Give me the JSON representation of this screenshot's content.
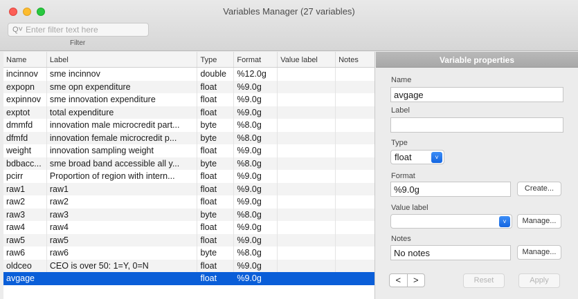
{
  "window": {
    "title": "Variables Manager (27 variables)"
  },
  "filter": {
    "placeholder": "Enter filter text here",
    "label": "Filter"
  },
  "table": {
    "columns": [
      "Name",
      "Label",
      "Type",
      "Format",
      "Value label",
      "Notes"
    ],
    "rows": [
      {
        "name": "incinnov",
        "label": "sme incinnov",
        "type": "double",
        "format": "%12.0g",
        "value_label": "",
        "notes": ""
      },
      {
        "name": "expopn",
        "label": "sme opn expenditure",
        "type": "float",
        "format": "%9.0g",
        "value_label": "",
        "notes": ""
      },
      {
        "name": "expinnov",
        "label": "sme innovation expenditure",
        "type": "float",
        "format": "%9.0g",
        "value_label": "",
        "notes": ""
      },
      {
        "name": "exptot",
        "label": "total expenditure",
        "type": "float",
        "format": "%9.0g",
        "value_label": "",
        "notes": ""
      },
      {
        "name": "dmmfd",
        "label": "innovation male microcredit part...",
        "type": "byte",
        "format": "%8.0g",
        "value_label": "",
        "notes": ""
      },
      {
        "name": "dfmfd",
        "label": "innovation female microcredit p...",
        "type": "byte",
        "format": "%8.0g",
        "value_label": "",
        "notes": ""
      },
      {
        "name": "weight",
        "label": "innovation sampling weight",
        "type": "float",
        "format": "%9.0g",
        "value_label": "",
        "notes": ""
      },
      {
        "name": "bdbacc...",
        "label": "sme broad band accessible all y...",
        "type": "byte",
        "format": "%8.0g",
        "value_label": "",
        "notes": ""
      },
      {
        "name": "pcirr",
        "label": "Proportion of region with intern...",
        "type": "float",
        "format": "%9.0g",
        "value_label": "",
        "notes": ""
      },
      {
        "name": "raw1",
        "label": "raw1",
        "type": "float",
        "format": "%9.0g",
        "value_label": "",
        "notes": ""
      },
      {
        "name": "raw2",
        "label": "raw2",
        "type": "float",
        "format": "%9.0g",
        "value_label": "",
        "notes": ""
      },
      {
        "name": "raw3",
        "label": "raw3",
        "type": "byte",
        "format": "%8.0g",
        "value_label": "",
        "notes": ""
      },
      {
        "name": "raw4",
        "label": "raw4",
        "type": "float",
        "format": "%9.0g",
        "value_label": "",
        "notes": ""
      },
      {
        "name": "raw5",
        "label": "raw5",
        "type": "float",
        "format": "%9.0g",
        "value_label": "",
        "notes": ""
      },
      {
        "name": "raw6",
        "label": "raw6",
        "type": "byte",
        "format": "%8.0g",
        "value_label": "",
        "notes": ""
      },
      {
        "name": "oldceo",
        "label": "CEO is over 50: 1=Y, 0=N",
        "type": "float",
        "format": "%9.0g",
        "value_label": "",
        "notes": ""
      },
      {
        "name": "avgage",
        "label": "",
        "type": "float",
        "format": "%9.0g",
        "value_label": "",
        "notes": "",
        "selected": true
      }
    ]
  },
  "properties": {
    "header": "Variable properties",
    "name_label": "Name",
    "name_value": "avgage",
    "label_label": "Label",
    "label_value": "",
    "type_label": "Type",
    "type_value": "float",
    "format_label": "Format",
    "format_value": "%9.0g",
    "create_button": "Create...",
    "value_label_label": "Value label",
    "value_label_value": "",
    "manage_value_label_button": "Manage...",
    "notes_label": "Notes",
    "notes_value": "No notes",
    "manage_notes_button": "Manage...",
    "prev_glyph": "<",
    "next_glyph": ">",
    "reset_button": "Reset",
    "apply_button": "Apply"
  },
  "colors": {
    "selection": "#0a5ed8",
    "accent": "#1365e0"
  }
}
